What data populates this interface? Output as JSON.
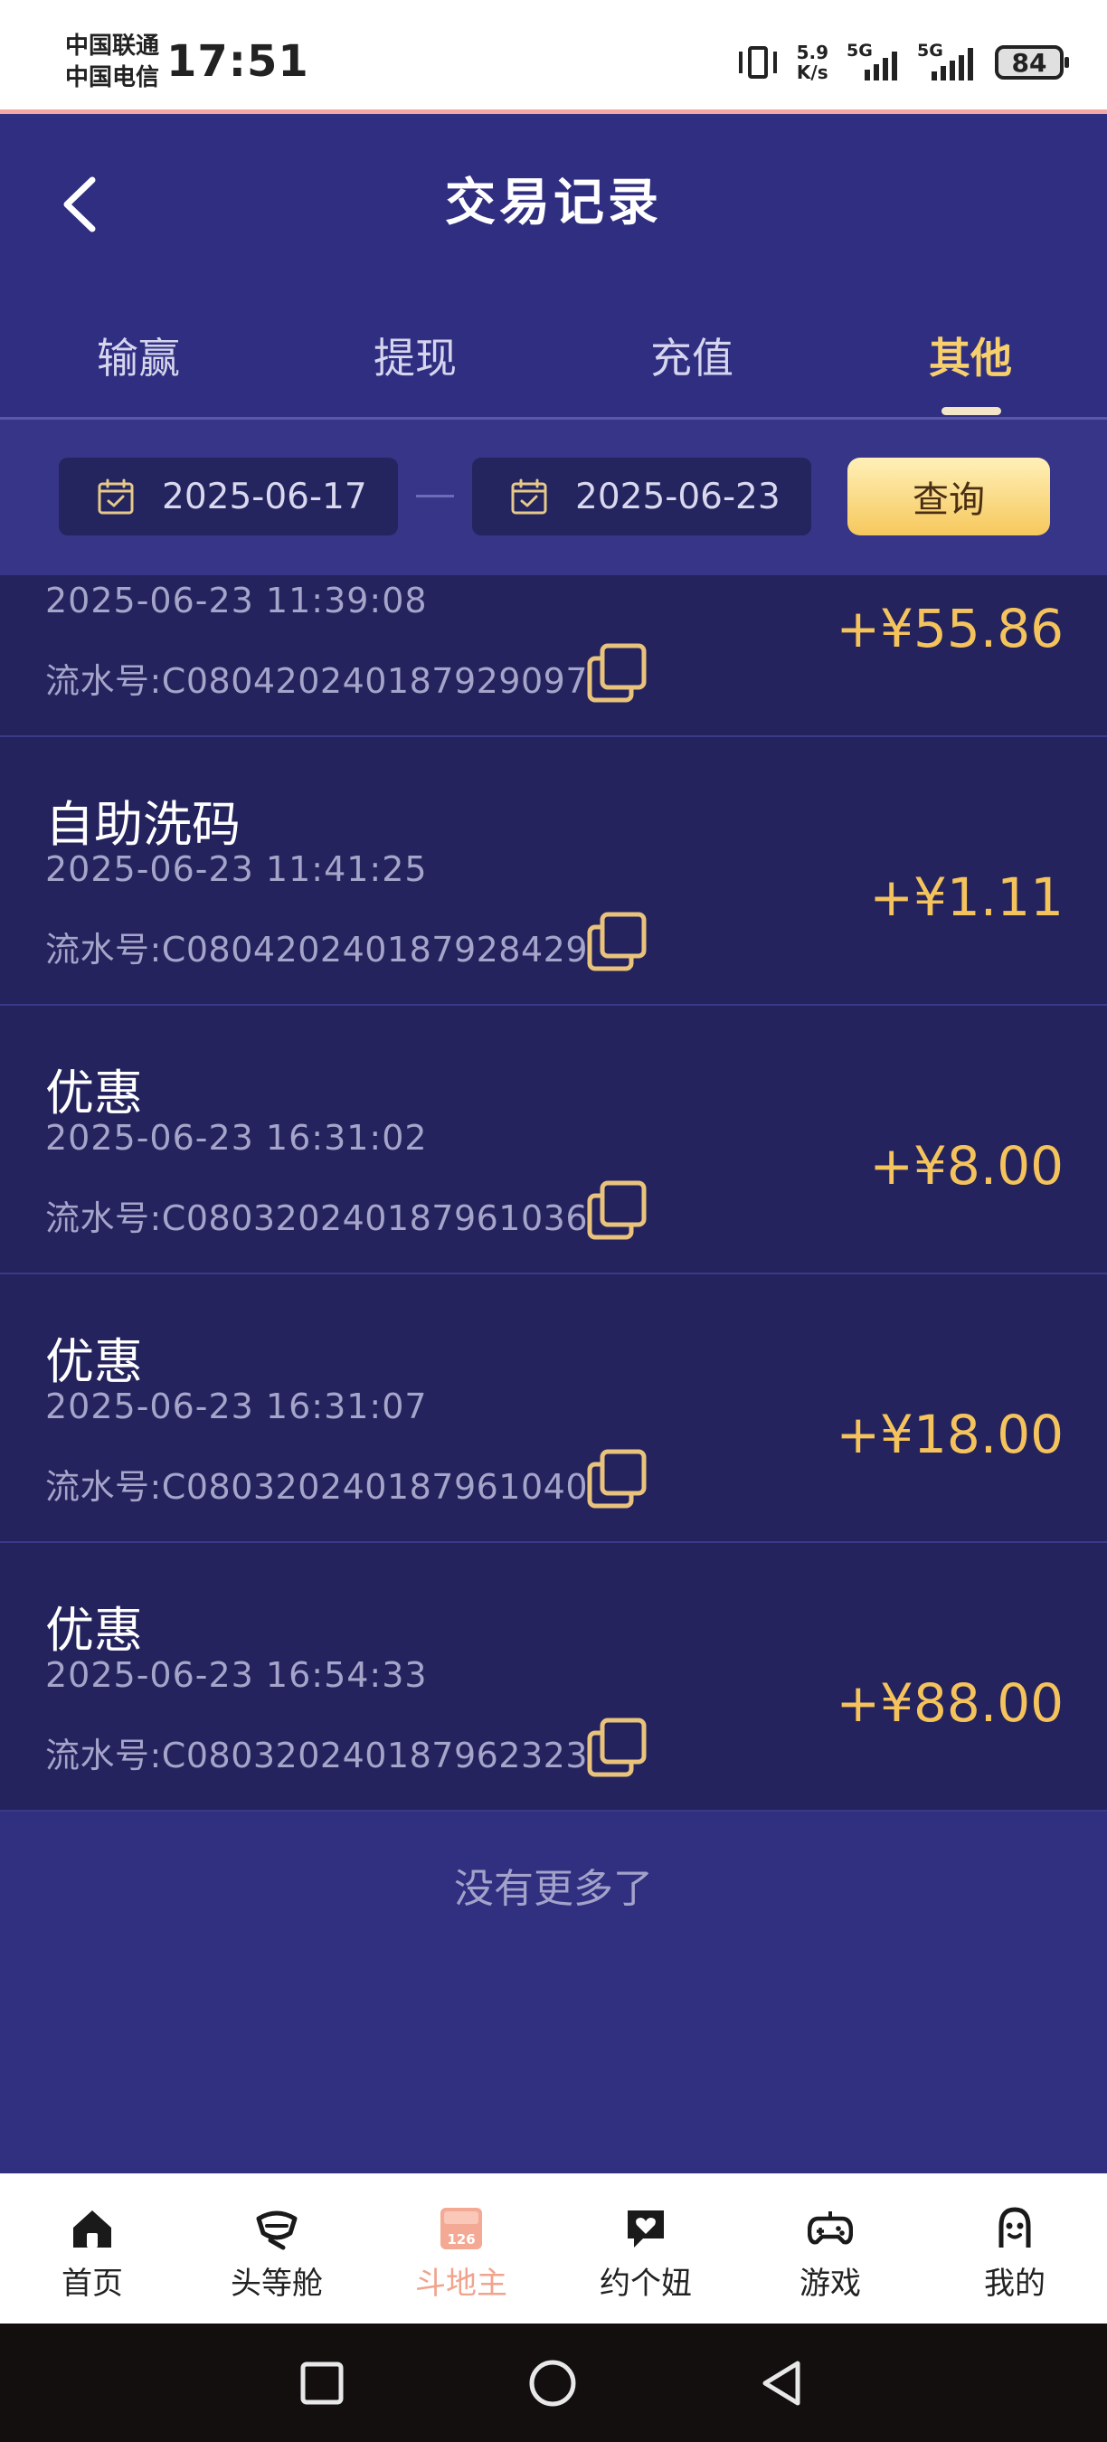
{
  "status_bar": {
    "carrier_1": "中国联通",
    "carrier_2": "中国电信",
    "time": "17:51",
    "speed_top": "5.9",
    "speed_bottom": "K/s",
    "sig_label_1": "5G",
    "sig_label_2": "5G",
    "battery": "84"
  },
  "header": {
    "title": "交易记录",
    "back_icon": "chevron-left-icon"
  },
  "tabs": [
    {
      "label": "输赢"
    },
    {
      "label": "提现"
    },
    {
      "label": "充值"
    },
    {
      "label": "其他",
      "active": true
    }
  ],
  "filter": {
    "start_date": "2025-06-17",
    "end_date": "2025-06-23",
    "query_label": "查询",
    "calendar_icon": "calendar-icon"
  },
  "records": [
    {
      "type": "",
      "time": "2025-06-23 11:39:08",
      "serial": "流水号:C080420240187929097",
      "amount": "+¥55.86"
    },
    {
      "type": "自助洗码",
      "time": "2025-06-23 11:41:25",
      "serial": "流水号:C080420240187928429",
      "amount": "+¥1.11"
    },
    {
      "type": "优惠",
      "time": "2025-06-23 16:31:02",
      "serial": "流水号:C080320240187961036",
      "amount": "+¥8.00"
    },
    {
      "type": "优惠",
      "time": "2025-06-23 16:31:07",
      "serial": "流水号:C080320240187961040",
      "amount": "+¥18.00"
    },
    {
      "type": "优惠",
      "time": "2025-06-23 16:54:33",
      "serial": "流水号:C080320240187962323",
      "amount": "+¥88.00"
    }
  ],
  "no_more": "没有更多了",
  "bottom_nav": [
    {
      "label": "首页",
      "icon": "home-icon"
    },
    {
      "label": "头等舱",
      "icon": "cabin-icon"
    },
    {
      "label": "斗地主",
      "icon": "doudizhu-icon",
      "active": true,
      "badge": "126"
    },
    {
      "label": "约个妞",
      "icon": "chat-heart-icon"
    },
    {
      "label": "游戏",
      "icon": "gamepad-icon"
    },
    {
      "label": "我的",
      "icon": "profile-icon"
    }
  ],
  "colors": {
    "accent_gold": "#f5c35c",
    "background": "#302e80",
    "card": "#24235e"
  }
}
